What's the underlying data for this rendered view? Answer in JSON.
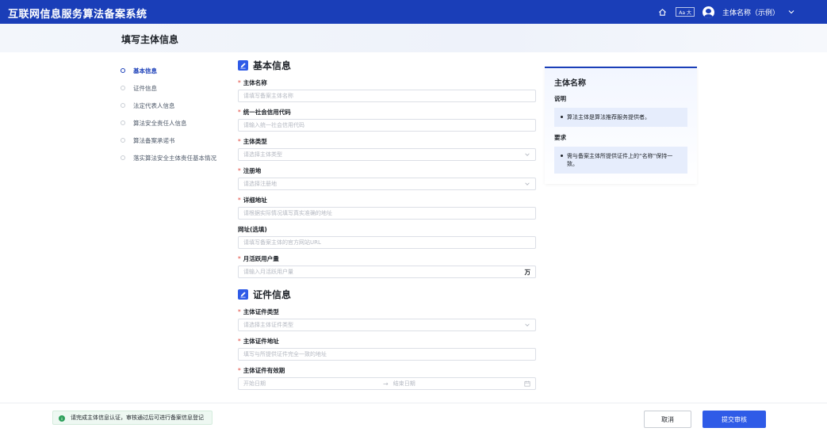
{
  "app": {
    "title": "互联网信息服务算法备案系统",
    "font_toggle_label": "Aa 大",
    "user_name": "主体名称（示例）"
  },
  "page": {
    "title": "填写主体信息"
  },
  "steps": [
    {
      "label": "基本信息",
      "active": true
    },
    {
      "label": "证件信息",
      "active": false
    },
    {
      "label": "法定代表人信息",
      "active": false
    },
    {
      "label": "算法安全责任人信息",
      "active": false
    },
    {
      "label": "算法备案承诺书",
      "active": false
    },
    {
      "label": "落实算法安全主体责任基本情况",
      "active": false
    }
  ],
  "sections": {
    "basic": {
      "title": "基本信息",
      "fields": {
        "name": {
          "label": "主体名称",
          "placeholder": "请填写备案主体名称"
        },
        "credit_code": {
          "label": "统一社会信用代码",
          "placeholder": "请输入统一社会信用代码"
        },
        "entity_type": {
          "label": "主体类型",
          "placeholder": "请选择主体类型"
        },
        "registration": {
          "label": "注册地",
          "placeholder": "请选择注册地"
        },
        "address": {
          "label": "详细地址",
          "placeholder": "请根据实际情况填写真实准确的地址"
        },
        "website": {
          "label": "网址(选填)",
          "placeholder": "请填写备案主体的官方网站URL"
        },
        "mau": {
          "label": "月活跃用户量",
          "placeholder": "请输入月活跃用户量",
          "suffix": "万"
        }
      }
    },
    "certificate": {
      "title": "证件信息",
      "fields": {
        "cert_type": {
          "label": "主体证件类型",
          "placeholder": "请选择主体证件类型"
        },
        "cert_address": {
          "label": "主体证件地址",
          "placeholder": "填写与所提供证件完全一致的地址"
        },
        "cert_validity": {
          "label": "主体证件有效期",
          "start_placeholder": "开始日期",
          "separator": "→",
          "end_placeholder": "结束日期"
        }
      }
    }
  },
  "side_card": {
    "title": "主体名称",
    "desc_label": "说明",
    "desc_text": "算法主体是算法推荐服务提供者。",
    "req_label": "要求",
    "req_text": "需与备案主体所提供证件上的“名称”保持一致。"
  },
  "footer": {
    "notice": "请完成主体信息认证，审核通过后可进行备案信息登记",
    "cancel_label": "取消",
    "submit_label": "提交审核"
  },
  "colors": {
    "primary": "#1a3eb8",
    "accent": "#2f5be7",
    "required": "#e0493e",
    "success": "#2ea05b"
  }
}
